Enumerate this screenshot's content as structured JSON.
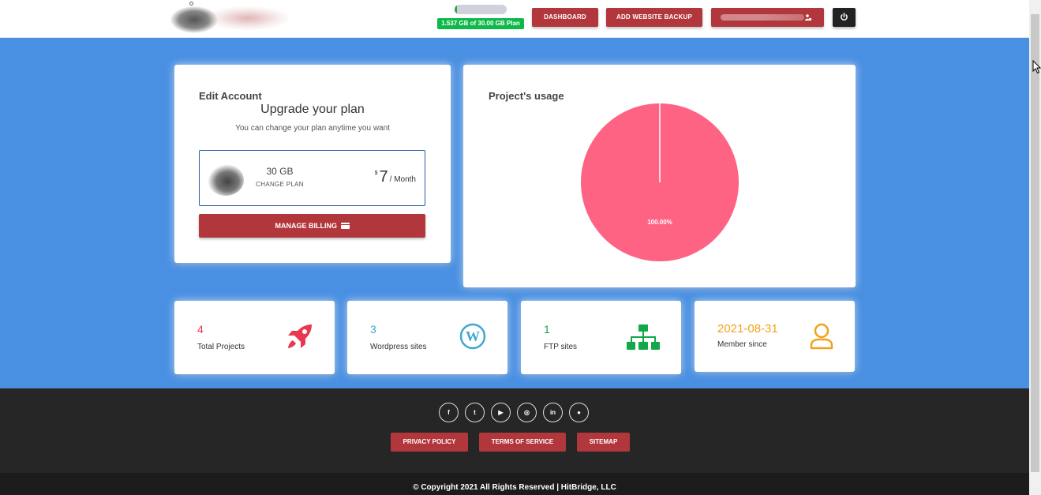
{
  "header": {
    "storage": {
      "used_fraction": 0.05,
      "badge": "1.537 GB of 30.00 GB Plan"
    },
    "nav": {
      "dashboard_label": "DASHBOARD",
      "add_backup_label": "ADD WEBSITE BACKUP"
    },
    "account_icon": "user-lock-icon",
    "power_icon": "power-icon"
  },
  "edit_account": {
    "title": "Edit Account",
    "upgrade_title": "Upgrade your plan",
    "upgrade_subtitle": "You can change your plan anytime you want",
    "plan": {
      "size": "30 GB",
      "change_label": "CHANGE PLAN",
      "currency": "$",
      "price": "7",
      "period": "/ Month"
    },
    "manage_billing_label": "MANAGE BILLING",
    "manage_billing_icon": "credit-card-icon"
  },
  "usage": {
    "title": "Project's usage",
    "chart_data": {
      "type": "pie",
      "slices": [
        {
          "value": 100.0,
          "label": "100.00%",
          "color": "#ff6384"
        }
      ]
    }
  },
  "stats": [
    {
      "value": "4",
      "label": "Total Projects",
      "color": "#e8374f",
      "icon": "rocket-icon"
    },
    {
      "value": "3",
      "label": "Wordpress sites",
      "color": "#3fa8cf",
      "icon": "wordpress-icon"
    },
    {
      "value": "1",
      "label": "FTP sites",
      "color": "#11a84a",
      "icon": "sitemap-icon"
    },
    {
      "value": "2021-08-31",
      "label": "Member since",
      "color": "#f1a21b",
      "icon": "user-icon"
    }
  ],
  "footer": {
    "socials": [
      {
        "icon": "facebook-icon",
        "glyph": "f"
      },
      {
        "icon": "twitter-icon",
        "glyph": "t"
      },
      {
        "icon": "youtube-icon",
        "glyph": "▶"
      },
      {
        "icon": "instagram-icon",
        "glyph": "◎"
      },
      {
        "icon": "linkedin-icon",
        "glyph": "in"
      },
      {
        "icon": "github-icon",
        "glyph": "●"
      }
    ],
    "privacy_label": "PRIVACY POLICY",
    "terms_label": "TERMS OF SERVICE",
    "sitemap_label": "SITEMAP",
    "copyright": "© Copyright 2021 All Rights Reserved | HitBridge, LLC"
  },
  "colors": {
    "brand_red": "#b1373c",
    "page_blue": "#4a90e2",
    "storage_green": "#0fb84a",
    "footer_dark": "#262626"
  }
}
